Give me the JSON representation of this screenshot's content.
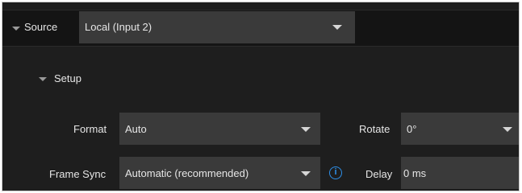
{
  "source": {
    "label": "Source",
    "value": "Local (Input 2)"
  },
  "setup": {
    "label": "Setup"
  },
  "format": {
    "label": "Format",
    "value": "Auto"
  },
  "rotate": {
    "label": "Rotate",
    "value": "0°"
  },
  "frame_sync": {
    "label": "Frame Sync",
    "value": "Automatic (recommended)"
  },
  "delay": {
    "label": "Delay",
    "value": "0 ms"
  },
  "info_icon": {
    "glyph": "i",
    "color": "#2e8fe8"
  }
}
